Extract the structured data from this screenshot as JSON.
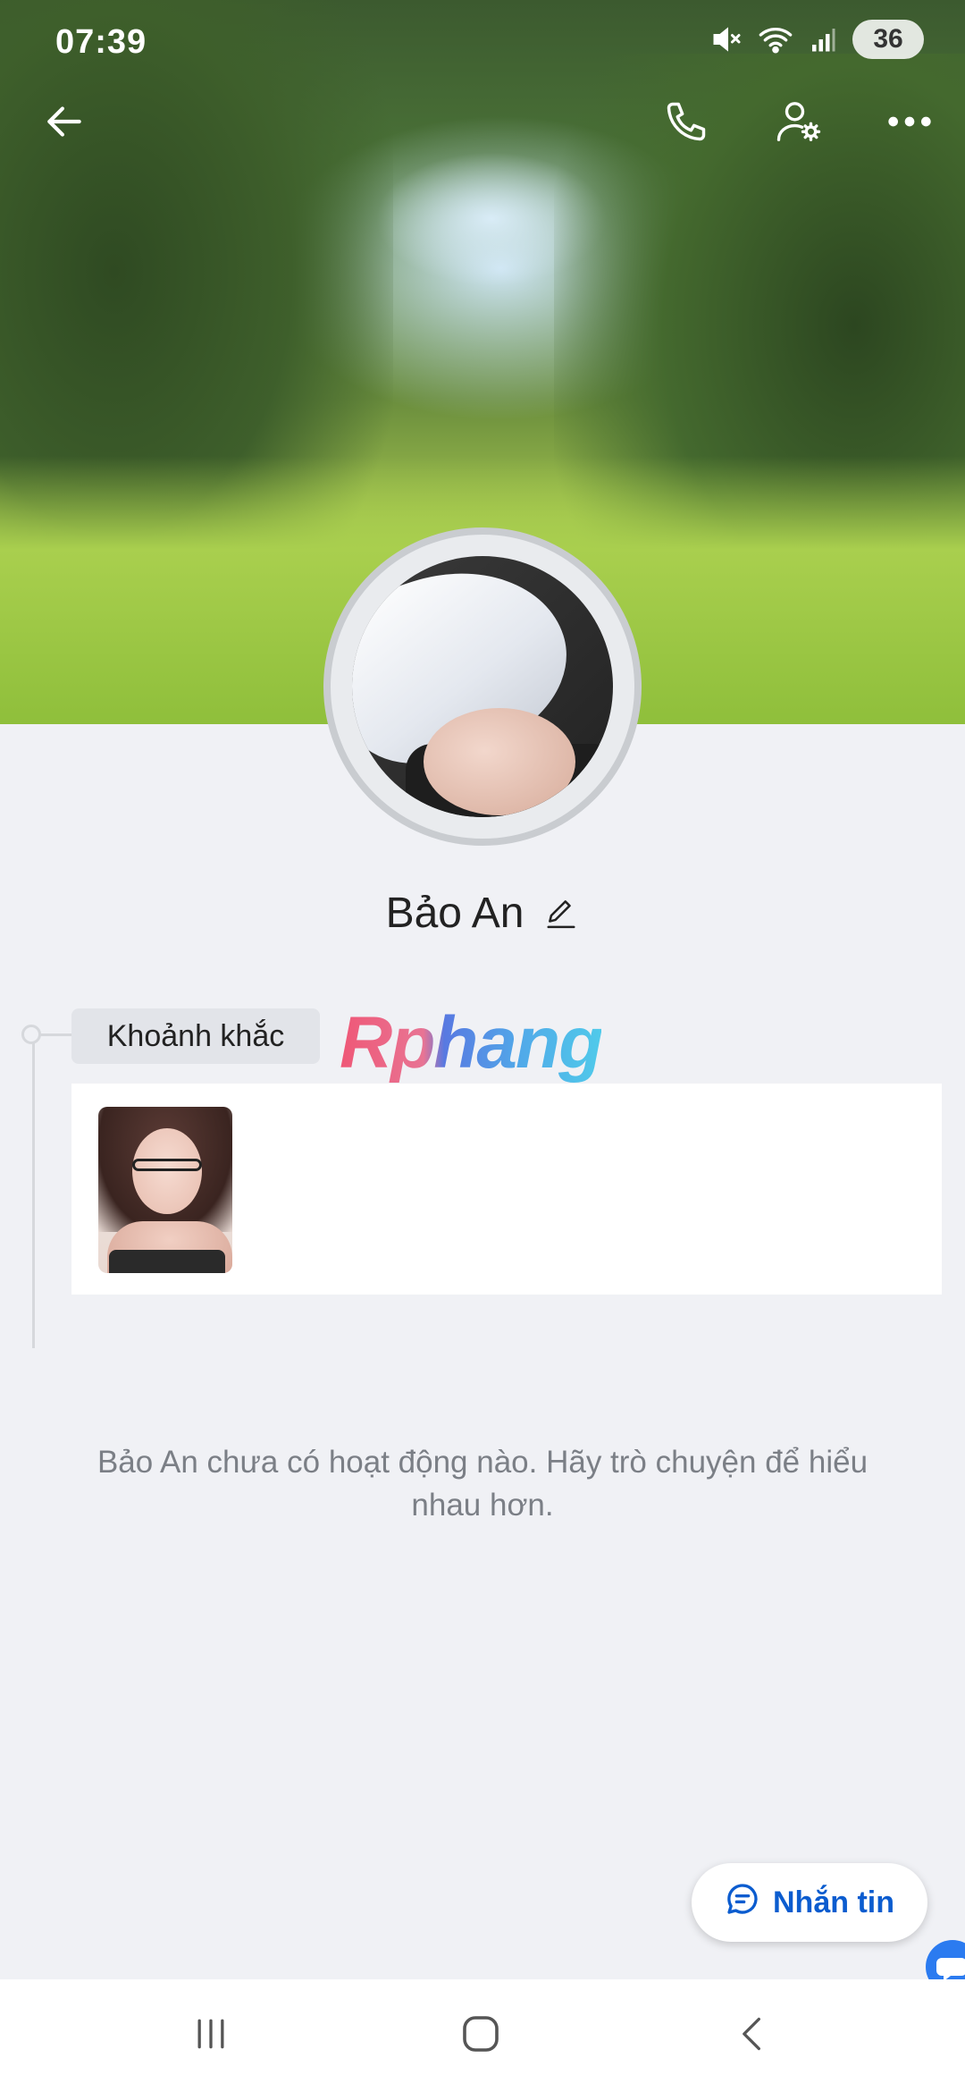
{
  "status_bar": {
    "time": "07:39",
    "battery": "36",
    "icons": [
      "mute-icon",
      "wifi-icon",
      "signal-icon",
      "battery-icon"
    ]
  },
  "top_bar": {
    "icons": [
      "back-arrow-icon",
      "phone-icon",
      "user-settings-icon",
      "more-dots-icon"
    ]
  },
  "profile": {
    "name": "Bảo An"
  },
  "moments": {
    "label": "Khoảnh khắc",
    "watermark": "Rphang"
  },
  "empty_state": {
    "message": "Bảo An chưa có hoạt động nào. Hãy trò chuyện để hiểu nhau hơn."
  },
  "message_button": {
    "label": "Nhắn tin"
  },
  "nav_bar": {
    "icons": [
      "recents-icon",
      "home-icon",
      "back-icon"
    ]
  },
  "colors": {
    "accent": "#0b5ccf",
    "background": "#f0f1f5",
    "muted_text": "#7b7f86"
  }
}
